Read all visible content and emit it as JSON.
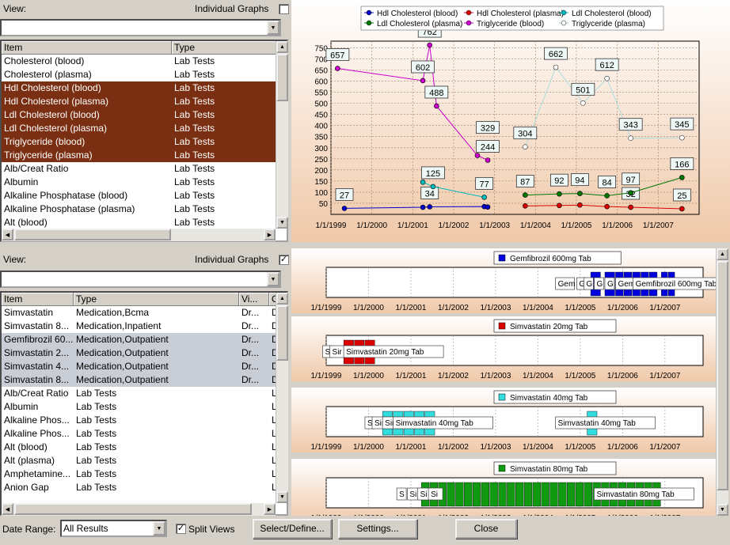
{
  "top_list": {
    "view_label": "View:",
    "individual_graphs_label": "Individual Graphs",
    "individual_graphs_checked": false,
    "columns": [
      "Item",
      "Type"
    ],
    "rows": [
      {
        "item": "Cholesterol (blood)",
        "type": "Lab Tests",
        "sel": ""
      },
      {
        "item": "Cholesterol (plasma)",
        "type": "Lab Tests",
        "sel": ""
      },
      {
        "item": "Hdl Cholesterol (blood)",
        "type": "Lab Tests",
        "sel": "b"
      },
      {
        "item": "Hdl Cholesterol (plasma)",
        "type": "Lab Tests",
        "sel": "b"
      },
      {
        "item": "Ldl Cholesterol (blood)",
        "type": "Lab Tests",
        "sel": "b"
      },
      {
        "item": "Ldl Cholesterol (plasma)",
        "type": "Lab Tests",
        "sel": "b"
      },
      {
        "item": "Triglyceride (blood)",
        "type": "Lab Tests",
        "sel": "b"
      },
      {
        "item": "Triglyceride (plasma)",
        "type": "Lab Tests",
        "sel": "b"
      },
      {
        "item": "Alb/Creat Ratio",
        "type": "Lab Tests",
        "sel": ""
      },
      {
        "item": "Albumin",
        "type": "Lab Tests",
        "sel": ""
      },
      {
        "item": "Alkaline Phosphatase (blood)",
        "type": "Lab Tests",
        "sel": ""
      },
      {
        "item": "Alkaline Phosphatase (plasma)",
        "type": "Lab Tests",
        "sel": ""
      },
      {
        "item": "Alt (blood)",
        "type": "Lab Tests",
        "sel": ""
      }
    ]
  },
  "bottom_list": {
    "view_label": "View:",
    "individual_graphs_label": "Individual Graphs",
    "individual_graphs_checked": true,
    "checkmark": "✓",
    "columns": [
      "Item",
      "Type",
      "Vi...",
      "C"
    ],
    "rows": [
      {
        "item": "Simvastatin",
        "type": "Medication,Bcma",
        "vi": "Dr...",
        "c": "D",
        "sel": ""
      },
      {
        "item": "Simvastatin 8...",
        "type": "Medication,Inpatient",
        "vi": "Dr...",
        "c": "D",
        "sel": ""
      },
      {
        "item": "Gemfibrozil 60...",
        "type": "Medication,Outpatient",
        "vi": "Dr...",
        "c": "D",
        "sel": "g"
      },
      {
        "item": "Simvastatin 2...",
        "type": "Medication,Outpatient",
        "vi": "Dr...",
        "c": "D",
        "sel": "g"
      },
      {
        "item": "Simvastatin 4...",
        "type": "Medication,Outpatient",
        "vi": "Dr...",
        "c": "D",
        "sel": "g"
      },
      {
        "item": "Simvastatin 8...",
        "type": "Medication,Outpatient",
        "vi": "Dr...",
        "c": "D",
        "sel": "g"
      },
      {
        "item": "Alb/Creat Ratio",
        "type": "Lab Tests",
        "vi": "",
        "c": "L",
        "sel": ""
      },
      {
        "item": "Albumin",
        "type": "Lab Tests",
        "vi": "",
        "c": "L",
        "sel": ""
      },
      {
        "item": "Alkaline Phos...",
        "type": "Lab Tests",
        "vi": "",
        "c": "L",
        "sel": ""
      },
      {
        "item": "Alkaline Phos...",
        "type": "Lab Tests",
        "vi": "",
        "c": "L",
        "sel": ""
      },
      {
        "item": "Alt (blood)",
        "type": "Lab Tests",
        "vi": "",
        "c": "L",
        "sel": ""
      },
      {
        "item": "Alt (plasma)",
        "type": "Lab Tests",
        "vi": "",
        "c": "L",
        "sel": ""
      },
      {
        "item": "Amphetamine...",
        "type": "Lab Tests",
        "vi": "",
        "c": "L",
        "sel": ""
      },
      {
        "item": "Anion Gap",
        "type": "Lab Tests",
        "vi": "",
        "c": "L",
        "sel": ""
      }
    ]
  },
  "footer": {
    "date_range_label": "Date Range:",
    "date_range_value": "All Results",
    "split_views_label": "Split Views",
    "split_views_checkmark": "✓",
    "select_define_label": "Select/Define...",
    "settings_label": "Settings...",
    "close_label": "Close"
  },
  "x_ticks": [
    "1/1/1999",
    "1/1/2000",
    "1/1/2001",
    "1/1/2002",
    "1/1/2003",
    "1/1/2004",
    "1/1/2005",
    "1/1/2006",
    "1/1/2007"
  ],
  "colors": {
    "hdl_blood": "#0000cc",
    "hdl_plasma": "#dd0000",
    "ldl_blood": "#00bbbb",
    "ldl_plasma": "#007700",
    "trig_blood": "#cc00cc",
    "trig_plasma": "#777777",
    "selected_row": "#7a2f12"
  },
  "chart_data": [
    {
      "type": "line",
      "ylim": [
        0,
        780
      ],
      "yticks": [
        50,
        100,
        150,
        200,
        250,
        300,
        350,
        400,
        450,
        500,
        550,
        600,
        650,
        700,
        750
      ],
      "xlim": [
        "1999-01-01",
        "2007-12-31"
      ],
      "legend": {
        "position": "top"
      },
      "series": [
        {
          "name": "Hdl Cholesterol (blood)",
          "points": [
            [
              "1999-05-01",
              27
            ],
            [
              "2001-04-01",
              32
            ],
            [
              "2001-06-01",
              34
            ],
            [
              "2002-10-01",
              35
            ],
            [
              "2002-11-01",
              33
            ]
          ],
          "labels": [
            [
              "1999-05-01",
              27
            ],
            [
              "2001-06-01",
              34
            ]
          ]
        },
        {
          "name": "Hdl Cholesterol (plasma)",
          "points": [
            [
              "2003-10-01",
              38
            ],
            [
              "2004-08-01",
              40
            ],
            [
              "2005-02-01",
              42
            ],
            [
              "2005-10-01",
              35
            ],
            [
              "2006-05-01",
              32
            ],
            [
              "2007-08-01",
              25
            ]
          ],
          "labels": [
            [
              "2006-05-01",
              32
            ],
            [
              "2007-08-01",
              25
            ]
          ]
        },
        {
          "name": "Ldl Cholesterol (blood)",
          "points": [
            [
              "2001-04-01",
              145
            ],
            [
              "2001-07-01",
              125
            ],
            [
              "2002-10-01",
              77
            ]
          ],
          "labels": [
            [
              "2001-07-01",
              125
            ],
            [
              "2002-10-01",
              77
            ]
          ]
        },
        {
          "name": "Ldl Cholesterol (plasma)",
          "points": [
            [
              "2003-10-01",
              87
            ],
            [
              "2004-08-01",
              92
            ],
            [
              "2005-02-01",
              94
            ],
            [
              "2005-10-01",
              84
            ],
            [
              "2006-05-01",
              97
            ],
            [
              "2007-08-01",
              166
            ]
          ],
          "labels": [
            [
              "2003-10-01",
              87
            ],
            [
              "2004-08-01",
              92
            ],
            [
              "2005-02-01",
              94
            ],
            [
              "2005-10-01",
              84
            ],
            [
              "2006-05-01",
              97
            ],
            [
              "2007-08-01",
              166
            ]
          ]
        },
        {
          "name": "Triglyceride (blood)",
          "points": [
            [
              "1999-03-01",
              657
            ],
            [
              "2001-04-01",
              602
            ],
            [
              "2001-06-01",
              762
            ],
            [
              "2001-08-01",
              488
            ],
            [
              "2002-08-01",
              265
            ],
            [
              "2002-11-01",
              244
            ]
          ],
          "labels": [
            [
              "1999-03-01",
              657
            ],
            [
              "2001-04-01",
              602
            ],
            [
              "2001-06-01",
              762
            ],
            [
              "2001-08-01",
              488
            ],
            [
              "2002-11-01",
              329
            ],
            [
              "2002-11-01",
              244
            ]
          ]
        },
        {
          "name": "Triglyceride (plasma)",
          "points": [
            [
              "2003-10-01",
              304
            ],
            [
              "2004-07-01",
              662
            ],
            [
              "2005-03-01",
              501
            ],
            [
              "2005-10-01",
              612
            ],
            [
              "2006-05-01",
              343
            ],
            [
              "2007-08-01",
              345
            ]
          ],
          "labels": [
            [
              "2003-10-01",
              304
            ],
            [
              "2004-07-01",
              662
            ],
            [
              "2005-03-01",
              501
            ],
            [
              "2005-10-01",
              612
            ],
            [
              "2006-05-01",
              343
            ],
            [
              "2007-08-01",
              345
            ]
          ]
        }
      ]
    },
    {
      "type": "bar",
      "title": "Gemfibrozil 600mg Tab",
      "color": "#0000dd",
      "bars": [
        [
          "2005-04-01",
          "2005-07-01"
        ],
        [
          "2005-08-01",
          "2005-11-01"
        ],
        [
          "2005-11-01",
          "2006-11-01"
        ],
        [
          "2006-12-01",
          "2007-04-01"
        ]
      ],
      "tags": [
        [
          "2004-06-01",
          "Gem"
        ],
        [
          "2004-12-01",
          "G"
        ],
        [
          "2005-02-01",
          "G"
        ],
        [
          "2005-05-01",
          "G"
        ],
        [
          "2005-08-01",
          "G"
        ],
        [
          "2005-11-01",
          "Gem"
        ],
        [
          "2006-04-01",
          "Gemfibrozil 600mg Tab"
        ]
      ]
    },
    {
      "type": "bar",
      "title": "Simvastatin 20mg Tab",
      "color": "#dd0000",
      "bars": [
        [
          "1999-06-01",
          "1999-09-01"
        ],
        [
          "1999-09-01",
          "1999-12-01"
        ],
        [
          "1999-12-01",
          "2000-03-01"
        ]
      ],
      "tags": [
        [
          "1998-12-01",
          "S"
        ],
        [
          "1999-02-01",
          "Sir"
        ],
        [
          "1999-06-01",
          "Simvastatin 20mg Tab"
        ]
      ]
    },
    {
      "type": "bar",
      "title": "Simvastatin 40mg Tab",
      "color": "#33dddd",
      "bars": [
        [
          "2000-05-01",
          "2000-08-01"
        ],
        [
          "2000-08-01",
          "2000-11-01"
        ],
        [
          "2000-11-01",
          "2001-02-01"
        ],
        [
          "2001-02-01",
          "2001-05-01"
        ],
        [
          "2001-05-01",
          "2001-08-01"
        ],
        [
          "2005-03-01",
          "2005-06-01"
        ]
      ],
      "tags": [
        [
          "1999-12-01",
          "S"
        ],
        [
          "2000-02-01",
          "Sir"
        ],
        [
          "2000-05-01",
          "Sir"
        ],
        [
          "2000-08-01",
          "Simvastatin 40mg Tab"
        ],
        [
          "2004-06-01",
          "Simvastatin 40mg Tab"
        ]
      ]
    },
    {
      "type": "bar",
      "title": "Simvastatin 80mg Tab",
      "color": "#119911",
      "bars": [
        [
          "2001-04-01",
          "2006-12-01"
        ]
      ],
      "tags": [
        [
          "2000-09-01",
          "S"
        ],
        [
          "2000-12-01",
          "Si"
        ],
        [
          "2001-03-01",
          "Si"
        ],
        [
          "2001-06-01",
          "Si"
        ],
        [
          "2005-05-01",
          "Simvastatin 80mg Tab"
        ]
      ]
    }
  ]
}
